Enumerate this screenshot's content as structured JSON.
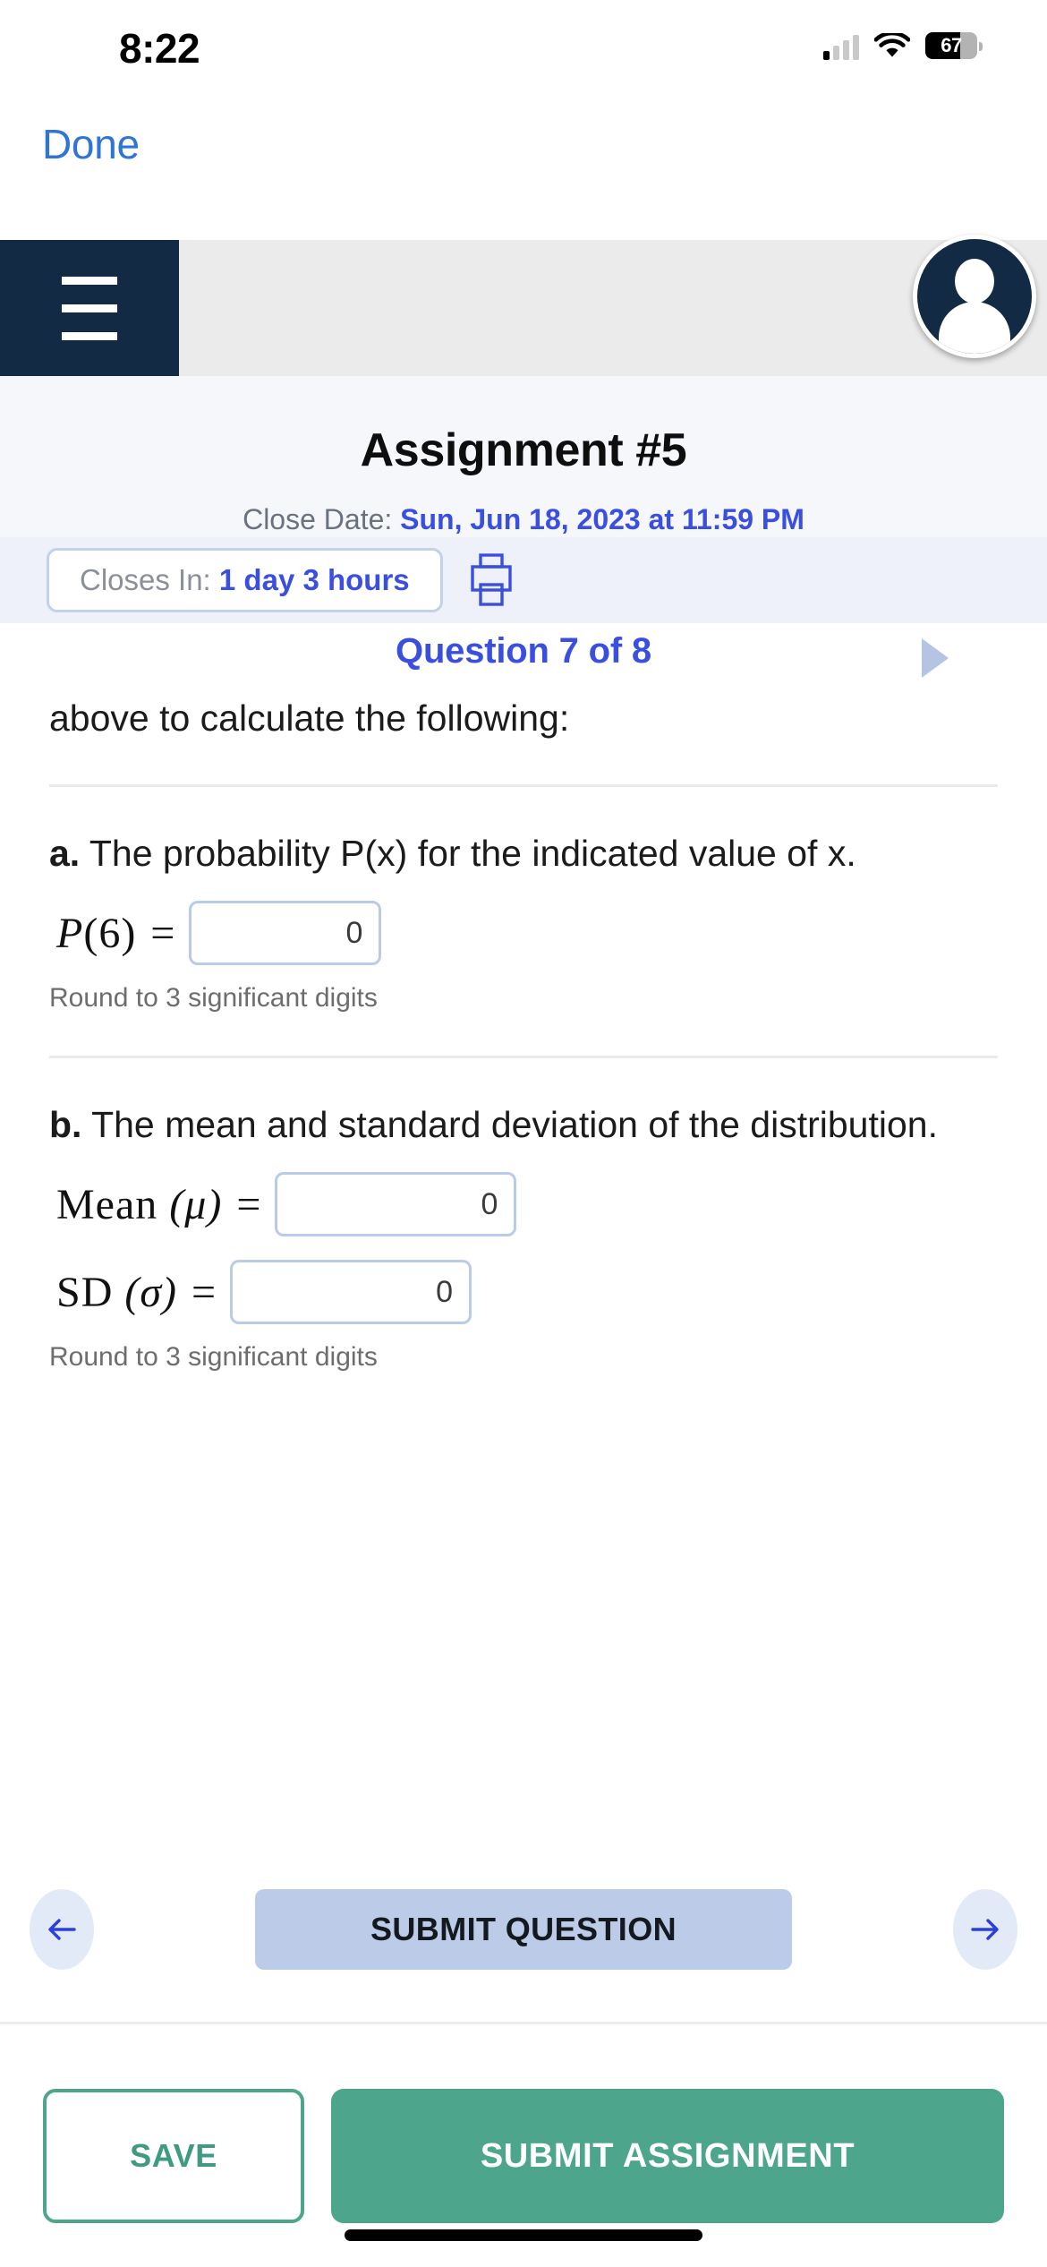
{
  "status_bar": {
    "time": "8:22",
    "battery_level": "67",
    "signal_icon": "cellular-signal-icon",
    "wifi_icon": "wifi-icon",
    "battery_icon": "battery-icon"
  },
  "nav": {
    "done_label": "Done"
  },
  "app_bar": {
    "menu_icon": "hamburger-menu-icon",
    "avatar_icon": "user-avatar-icon"
  },
  "assignment": {
    "title": "Assignment #5",
    "close_date_label": "Close Date:",
    "close_date_value": "Sun, Jun 18, 2023 at 11:59 PM",
    "closes_in_label": "Closes In:",
    "closes_in_value": "1 day 3 hours",
    "print_icon": "printer-icon"
  },
  "question_nav": {
    "label": "Question 7 of 8",
    "next_icon": "next-question-triangle-icon"
  },
  "question": {
    "intro": "above to calculate the following:",
    "parts": [
      {
        "letter": "a.",
        "text": " The probability P(x) for the indicated value of x.",
        "fields": [
          {
            "label_main": "P",
            "label_arg": "(6)",
            "equals": "=",
            "value": "0"
          }
        ],
        "hint": "Round to 3 significant digits"
      },
      {
        "letter": "b.",
        "text": " The mean and standard deviation of the distribution.",
        "fields": [
          {
            "label_main": "Mean",
            "label_arg": "(μ)",
            "equals": "=",
            "value": "0"
          },
          {
            "label_main": "SD",
            "label_arg": "(σ)",
            "equals": "=",
            "value": "0"
          }
        ],
        "hint": "Round to 3 significant digits"
      }
    ]
  },
  "actions": {
    "prev_icon": "previous-arrow-icon",
    "next_icon": "next-arrow-icon",
    "submit_question_label": "SUBMIT QUESTION",
    "save_label": "SAVE",
    "submit_assignment_label": "SUBMIT ASSIGNMENT"
  },
  "colors": {
    "brand_navy": "#122a43",
    "accent_blue": "#3a4fe0",
    "link_blue": "#2f75d6",
    "green": "#4da68c",
    "light_blue_fill": "#bccbe8",
    "page_bg_tint": "#f5f7fb"
  }
}
